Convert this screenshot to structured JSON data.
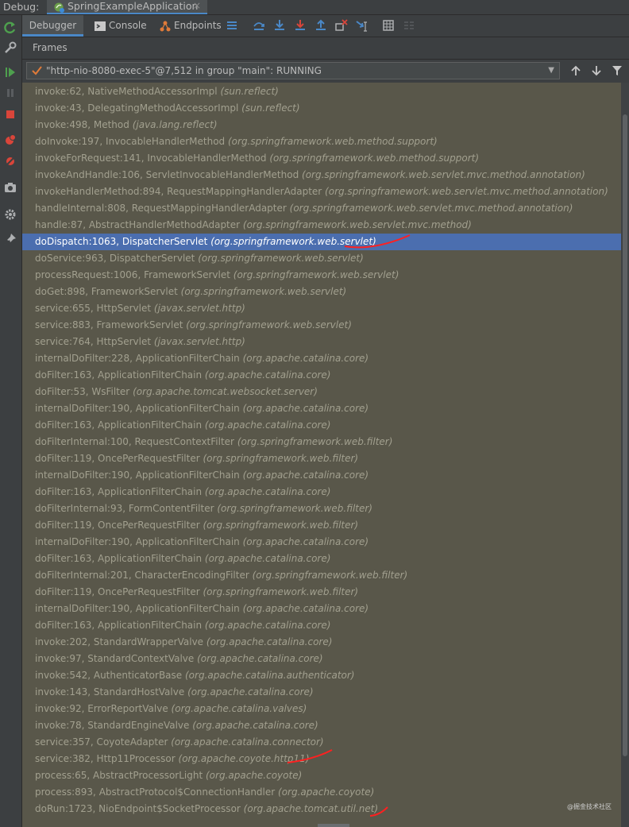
{
  "titlebar": {
    "label": "Debug:",
    "config_name": "SpringExampleApplication",
    "close_glyph": "×"
  },
  "tabs": {
    "debugger": "Debugger",
    "console": "Console",
    "endpoints": "Endpoints"
  },
  "frames_header": "Frames",
  "thread": {
    "label": "\"http-nio-8080-exec-5\"@7,512 in group \"main\": RUNNING"
  },
  "colors": {
    "accent": "#4a88c7",
    "selection": "#4b6eaf",
    "frames_bg": "#59574a",
    "annotation": "#ff2020"
  },
  "frames": [
    {
      "method": "invoke:62, NativeMethodAccessorImpl",
      "pkg": "(sun.reflect)"
    },
    {
      "method": "invoke:43, DelegatingMethodAccessorImpl",
      "pkg": "(sun.reflect)"
    },
    {
      "method": "invoke:498, Method",
      "pkg": "(java.lang.reflect)"
    },
    {
      "method": "doInvoke:197, InvocableHandlerMethod",
      "pkg": "(org.springframework.web.method.support)"
    },
    {
      "method": "invokeForRequest:141, InvocableHandlerMethod",
      "pkg": "(org.springframework.web.method.support)"
    },
    {
      "method": "invokeAndHandle:106, ServletInvocableHandlerMethod",
      "pkg": "(org.springframework.web.servlet.mvc.method.annotation)"
    },
    {
      "method": "invokeHandlerMethod:894, RequestMappingHandlerAdapter",
      "pkg": "(org.springframework.web.servlet.mvc.method.annotation)"
    },
    {
      "method": "handleInternal:808, RequestMappingHandlerAdapter",
      "pkg": "(org.springframework.web.servlet.mvc.method.annotation)"
    },
    {
      "method": "handle:87, AbstractHandlerMethodAdapter",
      "pkg": "(org.springframework.web.servlet.mvc.method)"
    },
    {
      "method": "doDispatch:1063, DispatcherServlet",
      "pkg": "(org.springframework.web.servlet)",
      "selected": true
    },
    {
      "method": "doService:963, DispatcherServlet",
      "pkg": "(org.springframework.web.servlet)"
    },
    {
      "method": "processRequest:1006, FrameworkServlet",
      "pkg": "(org.springframework.web.servlet)"
    },
    {
      "method": "doGet:898, FrameworkServlet",
      "pkg": "(org.springframework.web.servlet)"
    },
    {
      "method": "service:655, HttpServlet",
      "pkg": "(javax.servlet.http)"
    },
    {
      "method": "service:883, FrameworkServlet",
      "pkg": "(org.springframework.web.servlet)"
    },
    {
      "method": "service:764, HttpServlet",
      "pkg": "(javax.servlet.http)"
    },
    {
      "method": "internalDoFilter:228, ApplicationFilterChain",
      "pkg": "(org.apache.catalina.core)"
    },
    {
      "method": "doFilter:163, ApplicationFilterChain",
      "pkg": "(org.apache.catalina.core)"
    },
    {
      "method": "doFilter:53, WsFilter",
      "pkg": "(org.apache.tomcat.websocket.server)"
    },
    {
      "method": "internalDoFilter:190, ApplicationFilterChain",
      "pkg": "(org.apache.catalina.core)"
    },
    {
      "method": "doFilter:163, ApplicationFilterChain",
      "pkg": "(org.apache.catalina.core)"
    },
    {
      "method": "doFilterInternal:100, RequestContextFilter",
      "pkg": "(org.springframework.web.filter)"
    },
    {
      "method": "doFilter:119, OncePerRequestFilter",
      "pkg": "(org.springframework.web.filter)"
    },
    {
      "method": "internalDoFilter:190, ApplicationFilterChain",
      "pkg": "(org.apache.catalina.core)"
    },
    {
      "method": "doFilter:163, ApplicationFilterChain",
      "pkg": "(org.apache.catalina.core)"
    },
    {
      "method": "doFilterInternal:93, FormContentFilter",
      "pkg": "(org.springframework.web.filter)"
    },
    {
      "method": "doFilter:119, OncePerRequestFilter",
      "pkg": "(org.springframework.web.filter)"
    },
    {
      "method": "internalDoFilter:190, ApplicationFilterChain",
      "pkg": "(org.apache.catalina.core)"
    },
    {
      "method": "doFilter:163, ApplicationFilterChain",
      "pkg": "(org.apache.catalina.core)"
    },
    {
      "method": "doFilterInternal:201, CharacterEncodingFilter",
      "pkg": "(org.springframework.web.filter)"
    },
    {
      "method": "doFilter:119, OncePerRequestFilter",
      "pkg": "(org.springframework.web.filter)"
    },
    {
      "method": "internalDoFilter:190, ApplicationFilterChain",
      "pkg": "(org.apache.catalina.core)"
    },
    {
      "method": "doFilter:163, ApplicationFilterChain",
      "pkg": "(org.apache.catalina.core)"
    },
    {
      "method": "invoke:202, StandardWrapperValve",
      "pkg": "(org.apache.catalina.core)"
    },
    {
      "method": "invoke:97, StandardContextValve",
      "pkg": "(org.apache.catalina.core)"
    },
    {
      "method": "invoke:542, AuthenticatorBase",
      "pkg": "(org.apache.catalina.authenticator)"
    },
    {
      "method": "invoke:143, StandardHostValve",
      "pkg": "(org.apache.catalina.core)"
    },
    {
      "method": "invoke:92, ErrorReportValve",
      "pkg": "(org.apache.catalina.valves)"
    },
    {
      "method": "invoke:78, StandardEngineValve",
      "pkg": "(org.apache.catalina.core)"
    },
    {
      "method": "service:357, CoyoteAdapter",
      "pkg": "(org.apache.catalina.connector)"
    },
    {
      "method": "service:382, Http11Processor",
      "pkg": "(org.apache.coyote.http11)"
    },
    {
      "method": "process:65, AbstractProcessorLight",
      "pkg": "(org.apache.coyote)"
    },
    {
      "method": "process:893, AbstractProtocol$ConnectionHandler",
      "pkg": "(org.apache.coyote)"
    },
    {
      "method": "doRun:1723, NioEndpoint$SocketProcessor",
      "pkg": "(org.apache.tomcat.util.net)"
    }
  ],
  "watermark": "@掘金技术社区"
}
